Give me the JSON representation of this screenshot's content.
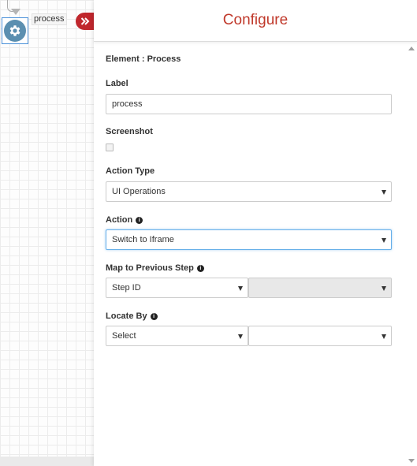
{
  "canvas": {
    "node_label": "process"
  },
  "panel": {
    "title": "Configure",
    "element_line": "Element : Process",
    "label_label": "Label",
    "label_value": "process",
    "screenshot_label": "Screenshot",
    "screenshot_checked": false,
    "action_type_label": "Action Type",
    "action_type_value": "UI Operations",
    "action_label": "Action",
    "action_value": "Switch to Iframe",
    "map_label": "Map to Previous Step",
    "map_value": "Step ID",
    "map_second_value": "",
    "locate_label": "Locate By",
    "locate_value": "Select",
    "locate_second_value": ""
  },
  "icons": {
    "info": "i",
    "node": "gear-icon",
    "collapse": "double-chevron-right-icon"
  },
  "colors": {
    "accent": "#c0272d",
    "title": "#c0392b",
    "node": "#5b8fb0",
    "focus": "#66afe9"
  }
}
